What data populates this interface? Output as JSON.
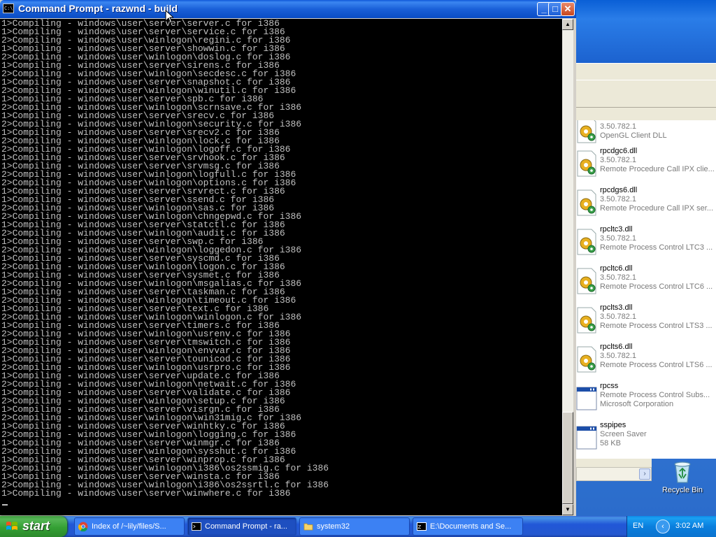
{
  "cmd_window": {
    "title": "Command Prompt - razwnd - build",
    "icon_label": "C:\\",
    "buttons": {
      "minimize": "_",
      "maximize": "□",
      "close": "✕"
    },
    "lines": [
      "1>Compiling - windows\\user\\server\\server.c for i386",
      "1>Compiling - windows\\user\\server\\service.c for i386",
      "2>Compiling - windows\\user\\winlogon\\regini.c for i386",
      "1>Compiling - windows\\user\\server\\showwin.c for i386",
      "2>Compiling - windows\\user\\winlogon\\doslog.c for i386",
      "1>Compiling - windows\\user\\server\\sirens.c for i386",
      "2>Compiling - windows\\user\\winlogon\\secdesc.c for i386",
      "1>Compiling - windows\\user\\server\\snapshot.c for i386",
      "2>Compiling - windows\\user\\winlogon\\winutil.c for i386",
      "1>Compiling - windows\\user\\server\\spb.c for i386",
      "2>Compiling - windows\\user\\winlogon\\scrnsave.c for i386",
      "1>Compiling - windows\\user\\server\\srecv.c for i386",
      "2>Compiling - windows\\user\\winlogon\\security.c for i386",
      "1>Compiling - windows\\user\\server\\srecv2.c for i386",
      "2>Compiling - windows\\user\\winlogon\\lock.c for i386",
      "2>Compiling - windows\\user\\winlogon\\logoff.c for i386",
      "1>Compiling - windows\\user\\server\\srvhook.c for i386",
      "1>Compiling - windows\\user\\server\\srvmsg.c for i386",
      "2>Compiling - windows\\user\\winlogon\\logfull.c for i386",
      "2>Compiling - windows\\user\\winlogon\\options.c for i386",
      "1>Compiling - windows\\user\\server\\srvrect.c for i386",
      "1>Compiling - windows\\user\\server\\ssend.c for i386",
      "2>Compiling - windows\\user\\winlogon\\sas.c for i386",
      "2>Compiling - windows\\user\\winlogon\\chngepwd.c for i386",
      "1>Compiling - windows\\user\\server\\statctl.c for i386",
      "2>Compiling - windows\\user\\winlogon\\audit.c for i386",
      "1>Compiling - windows\\user\\server\\swp.c for i386",
      "2>Compiling - windows\\user\\winlogon\\loggedon.c for i386",
      "1>Compiling - windows\\user\\server\\syscmd.c for i386",
      "2>Compiling - windows\\user\\winlogon\\logon.c for i386",
      "1>Compiling - windows\\user\\server\\sysmet.c for i386",
      "2>Compiling - windows\\user\\winlogon\\msgalias.c for i386",
      "1>Compiling - windows\\user\\server\\taskman.c for i386",
      "2>Compiling - windows\\user\\winlogon\\timeout.c for i386",
      "1>Compiling - windows\\user\\server\\text.c for i386",
      "2>Compiling - windows\\user\\winlogon\\winlogon.c for i386",
      "1>Compiling - windows\\user\\server\\timers.c for i386",
      "2>Compiling - windows\\user\\winlogon\\usrenv.c for i386",
      "1>Compiling - windows\\user\\server\\tmswitch.c for i386",
      "2>Compiling - windows\\user\\winlogon\\envvar.c for i386",
      "1>Compiling - windows\\user\\server\\tounicod.c for i386",
      "2>Compiling - windows\\user\\winlogon\\usrpro.c for i386",
      "1>Compiling - windows\\user\\server\\update.c for i386",
      "2>Compiling - windows\\user\\winlogon\\netwait.c for i386",
      "1>Compiling - windows\\user\\server\\validate.c for i386",
      "2>Compiling - windows\\user\\winlogon\\setup.c for i386",
      "1>Compiling - windows\\user\\server\\visrgn.c for i386",
      "2>Compiling - windows\\user\\winlogon\\win31mig.c for i386",
      "1>Compiling - windows\\user\\server\\winhtky.c for i386",
      "2>Compiling - windows\\user\\winlogon\\logging.c for i386",
      "1>Compiling - windows\\user\\server\\winmgr.c for i386",
      "2>Compiling - windows\\user\\winlogon\\sysshut.c for i386",
      "1>Compiling - windows\\user\\server\\winprop.c for i386",
      "2>Compiling - windows\\user\\winlogon\\i386\\os2ssmig.c for i386",
      "1>Compiling - windows\\user\\server\\winsta.c for i386",
      "2>Compiling - windows\\user\\winlogon\\i386\\os2ssrtl.c for i386",
      "1>Compiling - windows\\user\\server\\winwhere.c for i386"
    ]
  },
  "explorer": {
    "files": [
      {
        "name": "",
        "line1": "3.50.782.1",
        "line2": "OpenGL Client DLL",
        "icon": "dll-gear-icon"
      },
      {
        "name": "rpcdgc6.dll",
        "line1": "3.50.782.1",
        "line2": "Remote Procedure Call IPX clie...",
        "icon": "dll-gear-icon"
      },
      {
        "name": "rpcdgs6.dll",
        "line1": "3.50.782.1",
        "line2": "Remote Procedure Call IPX ser...",
        "icon": "dll-gear-icon"
      },
      {
        "name": "rpcltc3.dll",
        "line1": "3.50.782.1",
        "line2": "Remote Process Control LTC3 ...",
        "icon": "dll-gear-icon"
      },
      {
        "name": "rpcltc6.dll",
        "line1": "3.50.782.1",
        "line2": "Remote Process Control LTC6 ...",
        "icon": "dll-gear-icon"
      },
      {
        "name": "rpclts3.dll",
        "line1": "3.50.782.1",
        "line2": "Remote Process Control LTS3 ...",
        "icon": "dll-gear-icon"
      },
      {
        "name": "rpclts6.dll",
        "line1": "3.50.782.1",
        "line2": "Remote Process Control LTS6 ...",
        "icon": "dll-gear-icon"
      },
      {
        "name": "rpcss",
        "line1": "Remote Process Control Subs...",
        "line2": "Microsoft Corporation",
        "icon": "exe-window-icon"
      },
      {
        "name": "sspipes",
        "line1": "Screen Saver",
        "line2": "58 KB",
        "icon": "exe-window-icon"
      }
    ],
    "hscroll_arrow": "›"
  },
  "desktop": {
    "recycle_bin_label": "Recycle Bin"
  },
  "taskbar": {
    "start_label": "start",
    "tasks": [
      {
        "label": "Index of /~lily/files/S...",
        "icon": "chrome-icon"
      },
      {
        "label": "Command Prompt - ra...",
        "icon": "cmd-icon"
      },
      {
        "label": "system32",
        "icon": "folder-icon"
      },
      {
        "label": "E:\\Documents and Se...",
        "icon": "console-window-icon"
      }
    ],
    "language": "EN",
    "tray_arrow": "‹",
    "clock": "3:02 AM"
  },
  "colors": {
    "console_bg": "#000000",
    "console_text": "#c0c0c0",
    "xp_title_blue": "#0a4cc4",
    "start_green": "#34a034"
  }
}
